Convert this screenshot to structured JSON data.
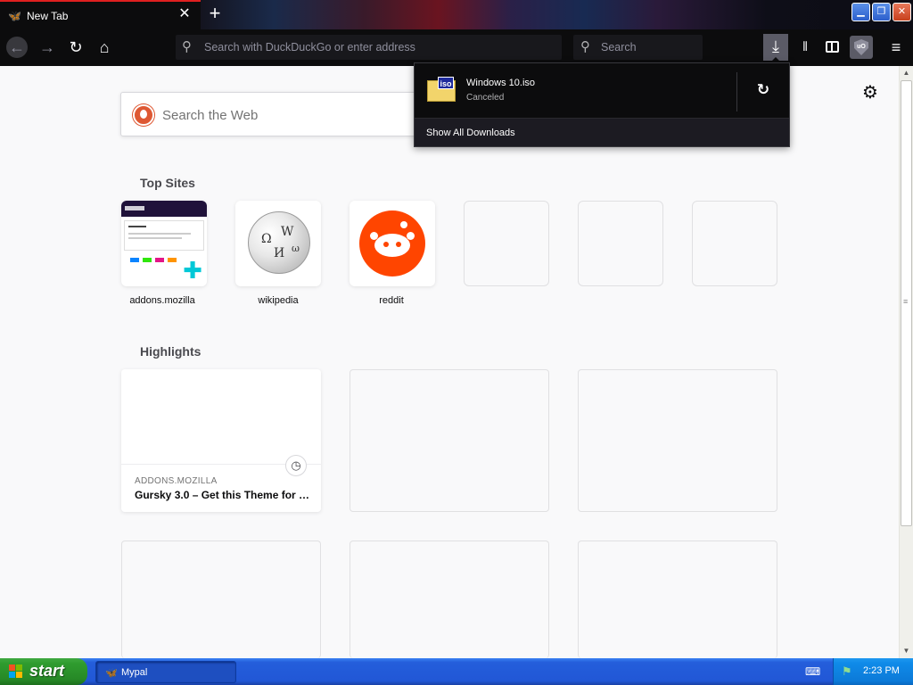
{
  "tab": {
    "title": "New Tab",
    "close_glyph": "✕",
    "favicon": "mypal-icon"
  },
  "newtab_glyph": "+",
  "window_controls": {
    "minimize": "▁",
    "maximize": "❐",
    "close": "✕"
  },
  "navbar": {
    "back_glyph": "←",
    "forward_glyph": "→",
    "reload_glyph": "↻",
    "home_glyph": "⌂",
    "url_placeholder": "Search with DuckDuckGo or enter address",
    "search_placeholder": "Search",
    "search_glyph": "⚲",
    "downloads_glyph": "⤓",
    "library_glyph": "𝍪",
    "ublock_label": "uO",
    "menu_glyph": "≡"
  },
  "newtab": {
    "websearch_placeholder": "Search the Web",
    "settings_glyph": "⚙",
    "topsites_title": "Top Sites",
    "topsites": [
      {
        "label": "addons.mozilla"
      },
      {
        "label": "wikipedia"
      },
      {
        "label": "reddit"
      }
    ],
    "highlights_title": "Highlights",
    "highlights": [
      {
        "host": "ADDONS.MOZILLA",
        "title": "Gursky 3.0 – Get this Theme for …",
        "clock_glyph": "◷"
      }
    ]
  },
  "downloads_panel": {
    "file_type": "iso",
    "file_name": "Windows 10.iso",
    "status": "Canceled",
    "retry_glyph": "↻",
    "show_all": "Show All Downloads"
  },
  "taskbar": {
    "start_label": "start",
    "task_label": "Mypal",
    "clock": "2:23 PM"
  },
  "colors": {
    "accent_tab": "#e02020",
    "start_green": "#2f9c2f",
    "taskbar_blue": "#245edb",
    "reddit_orange": "#ff4500",
    "ddg_orange": "#de5833"
  }
}
